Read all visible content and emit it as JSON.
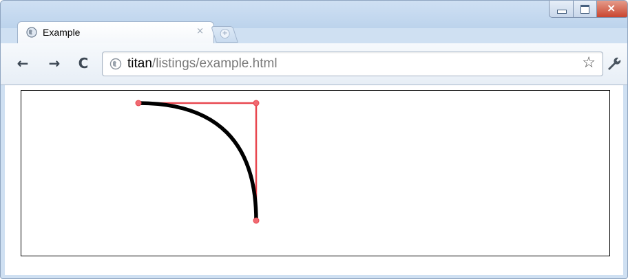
{
  "window": {
    "controls": {
      "minimize_icon": "minimize-icon",
      "maximize_icon": "maximize-icon",
      "close_icon": "close-icon",
      "close_color": "#c9452f"
    }
  },
  "tabs": [
    {
      "title": "Example",
      "icon": "globe-icon",
      "close_glyph": "×",
      "active": true
    }
  ],
  "new_tab": {
    "icon": "new-tab-icon"
  },
  "toolbar": {
    "back_glyph": "←",
    "forward_glyph": "→",
    "reload_glyph": "C",
    "address": {
      "host": "titan",
      "path": "/listings/example.html"
    },
    "bookmark_glyph": "☆",
    "menu_icon": "wrench-icon"
  },
  "canvas": {
    "curve": {
      "color": "#000000",
      "kind": "quadratic-curve"
    },
    "control_lines": {
      "color": "#e8474f"
    }
  }
}
